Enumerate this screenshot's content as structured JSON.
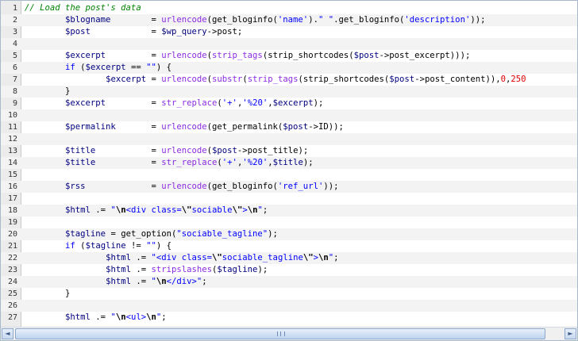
{
  "scrollbar": {
    "left_arrow": "◄",
    "right_arrow": "►"
  },
  "code": [
    {
      "n": "1",
      "alt": false,
      "t": [
        [
          "c",
          "// Load the post's data"
        ]
      ]
    },
    {
      "n": "2",
      "alt": true,
      "t": [
        [
          "o",
          "        "
        ],
        [
          "v",
          "$blogname"
        ],
        [
          "o",
          "        = "
        ],
        [
          "f",
          "urlencode"
        ],
        [
          "o",
          "(get_bloginfo("
        ],
        [
          "s",
          "'name'"
        ],
        [
          "o",
          ")."
        ],
        [
          "s",
          "\" \""
        ],
        [
          "o",
          ".get_bloginfo("
        ],
        [
          "s",
          "'description'"
        ],
        [
          "o",
          "));"
        ]
      ]
    },
    {
      "n": "3",
      "alt": false,
      "t": [
        [
          "o",
          "        "
        ],
        [
          "v",
          "$post"
        ],
        [
          "o",
          "            = "
        ],
        [
          "v",
          "$wp_query"
        ],
        [
          "o",
          "->post;"
        ]
      ]
    },
    {
      "n": "4",
      "alt": true,
      "t": []
    },
    {
      "n": "5",
      "alt": false,
      "t": [
        [
          "o",
          "        "
        ],
        [
          "v",
          "$excerpt"
        ],
        [
          "o",
          "         = "
        ],
        [
          "f",
          "urlencode"
        ],
        [
          "o",
          "("
        ],
        [
          "f",
          "strip_tags"
        ],
        [
          "o",
          "(strip_shortcodes("
        ],
        [
          "v",
          "$post"
        ],
        [
          "o",
          "->post_excerpt)));"
        ]
      ]
    },
    {
      "n": "6",
      "alt": true,
      "t": [
        [
          "o",
          "        "
        ],
        [
          "k",
          "if"
        ],
        [
          "o",
          " ("
        ],
        [
          "v",
          "$excerpt"
        ],
        [
          "o",
          " == "
        ],
        [
          "s",
          "\"\""
        ],
        [
          "o",
          ") {"
        ]
      ]
    },
    {
      "n": "7",
      "alt": false,
      "t": [
        [
          "o",
          "                "
        ],
        [
          "v",
          "$excerpt"
        ],
        [
          "o",
          " = "
        ],
        [
          "f",
          "urlencode"
        ],
        [
          "o",
          "("
        ],
        [
          "f",
          "substr"
        ],
        [
          "o",
          "("
        ],
        [
          "f",
          "strip_tags"
        ],
        [
          "o",
          "(strip_shortcodes("
        ],
        [
          "v",
          "$post"
        ],
        [
          "o",
          "->post_content)),"
        ],
        [
          "n",
          "0"
        ],
        [
          "o",
          ","
        ],
        [
          "n",
          "250"
        ]
      ]
    },
    {
      "n": "8",
      "alt": true,
      "t": [
        [
          "o",
          "        }"
        ]
      ]
    },
    {
      "n": "9",
      "alt": false,
      "t": [
        [
          "o",
          "        "
        ],
        [
          "v",
          "$excerpt"
        ],
        [
          "o",
          "         = "
        ],
        [
          "f",
          "str_replace"
        ],
        [
          "o",
          "("
        ],
        [
          "s",
          "'+'"
        ],
        [
          "o",
          ","
        ],
        [
          "s",
          "'%20'"
        ],
        [
          "o",
          ","
        ],
        [
          "v",
          "$excerpt"
        ],
        [
          "o",
          ");"
        ]
      ]
    },
    {
      "n": "10",
      "alt": true,
      "t": []
    },
    {
      "n": "11",
      "alt": false,
      "t": [
        [
          "o",
          "        "
        ],
        [
          "v",
          "$permalink"
        ],
        [
          "o",
          "       = "
        ],
        [
          "f",
          "urlencode"
        ],
        [
          "o",
          "(get_permalink("
        ],
        [
          "v",
          "$post"
        ],
        [
          "o",
          "->ID));"
        ]
      ]
    },
    {
      "n": "12",
      "alt": true,
      "t": []
    },
    {
      "n": "13",
      "alt": false,
      "t": [
        [
          "o",
          "        "
        ],
        [
          "v",
          "$title"
        ],
        [
          "o",
          "           = "
        ],
        [
          "f",
          "urlencode"
        ],
        [
          "o",
          "("
        ],
        [
          "v",
          "$post"
        ],
        [
          "o",
          "->post_title);"
        ]
      ]
    },
    {
      "n": "14",
      "alt": true,
      "t": [
        [
          "o",
          "        "
        ],
        [
          "v",
          "$title"
        ],
        [
          "o",
          "           = "
        ],
        [
          "f",
          "str_replace"
        ],
        [
          "o",
          "("
        ],
        [
          "s",
          "'+'"
        ],
        [
          "o",
          ","
        ],
        [
          "s",
          "'%20'"
        ],
        [
          "o",
          ","
        ],
        [
          "v",
          "$title"
        ],
        [
          "o",
          ");"
        ]
      ]
    },
    {
      "n": "15",
      "alt": false,
      "t": []
    },
    {
      "n": "16",
      "alt": true,
      "t": [
        [
          "o",
          "        "
        ],
        [
          "v",
          "$rss"
        ],
        [
          "o",
          "             = "
        ],
        [
          "f",
          "urlencode"
        ],
        [
          "o",
          "(get_bloginfo("
        ],
        [
          "s",
          "'ref_url'"
        ],
        [
          "o",
          "));"
        ]
      ]
    },
    {
      "n": "17",
      "alt": false,
      "t": []
    },
    {
      "n": "18",
      "alt": true,
      "t": [
        [
          "o",
          "        "
        ],
        [
          "v",
          "$html"
        ],
        [
          "o",
          " .= "
        ],
        [
          "s",
          "\""
        ],
        [
          "e",
          "\\n"
        ],
        [
          "s",
          "<div class="
        ],
        [
          "e",
          "\\\""
        ],
        [
          "s",
          "sociable"
        ],
        [
          "e",
          "\\\""
        ],
        [
          "s",
          ">"
        ],
        [
          "e",
          "\\n"
        ],
        [
          "s",
          "\""
        ],
        [
          "o",
          ";"
        ]
      ]
    },
    {
      "n": "19",
      "alt": false,
      "t": []
    },
    {
      "n": "20",
      "alt": true,
      "t": [
        [
          "o",
          "        "
        ],
        [
          "v",
          "$tagline"
        ],
        [
          "o",
          " = get_option("
        ],
        [
          "s",
          "\"sociable_tagline\""
        ],
        [
          "o",
          ");"
        ]
      ]
    },
    {
      "n": "21",
      "alt": false,
      "t": [
        [
          "o",
          "        "
        ],
        [
          "k",
          "if"
        ],
        [
          "o",
          " ("
        ],
        [
          "v",
          "$tagline"
        ],
        [
          "o",
          " != "
        ],
        [
          "s",
          "\"\""
        ],
        [
          "o",
          ") {"
        ]
      ]
    },
    {
      "n": "22",
      "alt": true,
      "t": [
        [
          "o",
          "                "
        ],
        [
          "v",
          "$html"
        ],
        [
          "o",
          " .= "
        ],
        [
          "s",
          "\"<div class="
        ],
        [
          "e",
          "\\\""
        ],
        [
          "s",
          "sociable_tagline"
        ],
        [
          "e",
          "\\\""
        ],
        [
          "s",
          ">"
        ],
        [
          "e",
          "\\n"
        ],
        [
          "s",
          "\""
        ],
        [
          "o",
          ";"
        ]
      ]
    },
    {
      "n": "23",
      "alt": false,
      "t": [
        [
          "o",
          "                "
        ],
        [
          "v",
          "$html"
        ],
        [
          "o",
          " .= "
        ],
        [
          "f",
          "stripslashes"
        ],
        [
          "o",
          "("
        ],
        [
          "v",
          "$tagline"
        ],
        [
          "o",
          ");"
        ]
      ]
    },
    {
      "n": "24",
      "alt": true,
      "t": [
        [
          "o",
          "                "
        ],
        [
          "v",
          "$html"
        ],
        [
          "o",
          " .= "
        ],
        [
          "s",
          "\""
        ],
        [
          "e",
          "\\n"
        ],
        [
          "s",
          "</div>\""
        ],
        [
          "o",
          ";"
        ]
      ]
    },
    {
      "n": "25",
      "alt": false,
      "t": [
        [
          "o",
          "        }"
        ]
      ]
    },
    {
      "n": "26",
      "alt": true,
      "t": []
    },
    {
      "n": "27",
      "alt": false,
      "t": [
        [
          "o",
          "        "
        ],
        [
          "v",
          "$html"
        ],
        [
          "o",
          " .= "
        ],
        [
          "s",
          "\""
        ],
        [
          "e",
          "\\n"
        ],
        [
          "s",
          "<ul>"
        ],
        [
          "e",
          "\\n"
        ],
        [
          "s",
          "\""
        ],
        [
          "o",
          ";"
        ]
      ]
    }
  ]
}
